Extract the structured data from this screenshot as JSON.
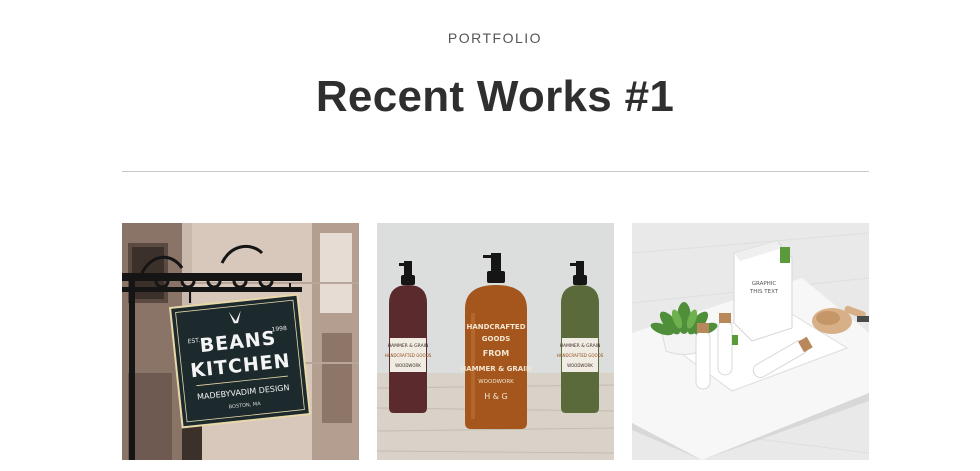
{
  "section": {
    "eyebrow": "PORTFOLIO",
    "title": "Recent Works #1"
  },
  "works": [
    {
      "sign_line1": "BEANS",
      "sign_line2": "KITCHEN",
      "sign_est": "EST.",
      "sign_year": "1998",
      "sign_credit": "MADEBYVADIM DESIGN",
      "sign_place": "BOSTON, MA"
    },
    {
      "left_label_title": "HAMMER & GRAIN",
      "left_label_sub": "HANDCRAFTED GOODS",
      "left_label_foot": "WOODWORK",
      "center_label_top": "HANDCRAFTED",
      "center_label_goods": "GOODS",
      "center_label_from": "FROM",
      "center_label_brand": "HAMMER & GRAIN",
      "center_label_foot": "WOODWORK",
      "center_label_mark": "H & G",
      "right_label_title": "HAMMER & GRAIN",
      "right_label_sub": "HANDCRAFTED GOODS",
      "right_label_foot": "WOODWORK"
    },
    {
      "bag_line1": "GRAPHIC",
      "bag_line2": "THIS TEXT"
    }
  ],
  "colors": {
    "sign_board": "#1c2a2e",
    "amber": "#a4561c",
    "wine": "#5a2a2c",
    "olive": "#5a6a3a",
    "plant_green": "#4f8f3a"
  }
}
